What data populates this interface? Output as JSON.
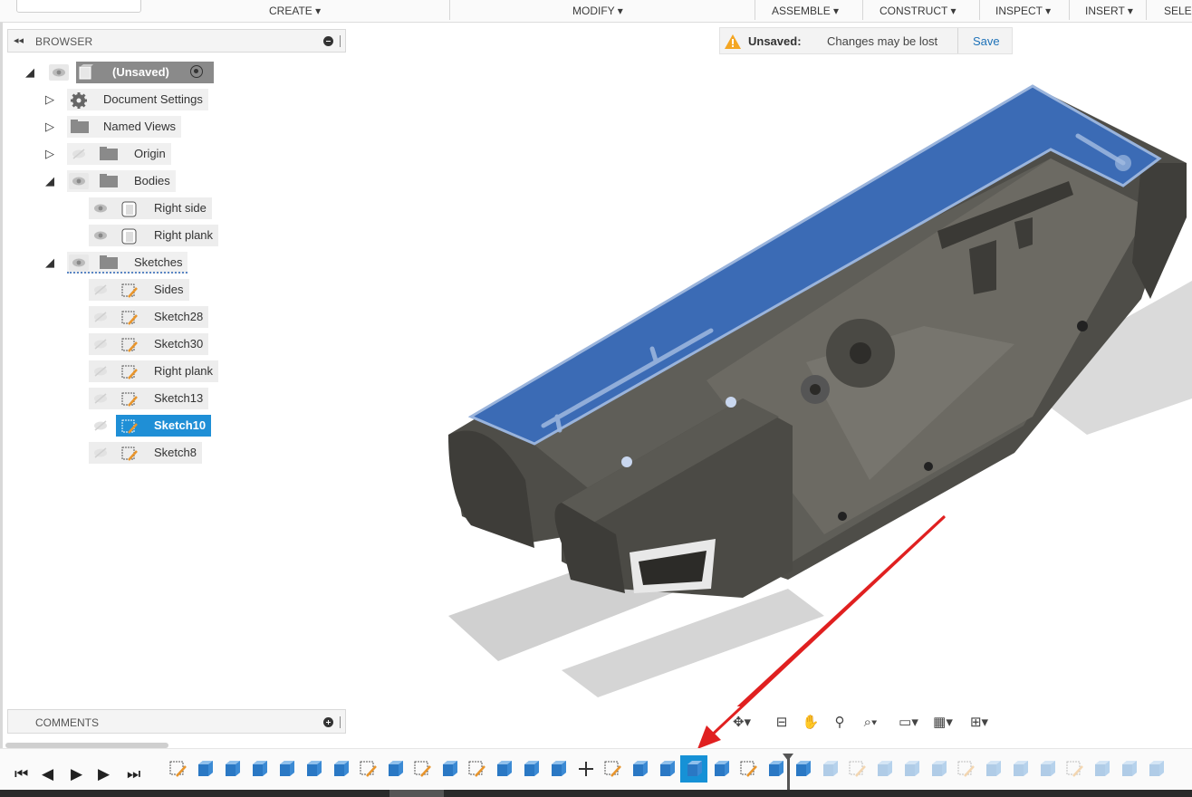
{
  "toolbar": {
    "create": "CREATE ▾",
    "modify": "MODIFY ▾",
    "assemble": "ASSEMBLE ▾",
    "construct": "CONSTRUCT ▾",
    "inspect": "INSPECT ▾",
    "insert": "INSERT ▾",
    "select": "SELE"
  },
  "browser": {
    "title": "BROWSER",
    "root": "(Unsaved)",
    "items": [
      {
        "label": "Document Settings",
        "icon": "gear-icon"
      },
      {
        "label": "Named Views",
        "icon": "folder-icon"
      },
      {
        "label": "Origin",
        "icon": "folder-icon"
      },
      {
        "label": "Bodies",
        "icon": "folder-icon"
      }
    ],
    "bodies": [
      "Right side",
      "Right plank"
    ],
    "sketches_label": "Sketches",
    "sketches": [
      "Sides",
      "Sketch28",
      "Sketch30",
      "Right plank",
      "Sketch13",
      "Sketch10",
      "Sketch8"
    ],
    "selected_sketch": "Sketch10"
  },
  "comments": {
    "title": "COMMENTS"
  },
  "banner": {
    "status": "Unsaved:",
    "message": "Changes may be lost",
    "save": "Save"
  },
  "colors": {
    "accent": "#1f8fd6",
    "model_face": "#3b6bb5",
    "model_metal": "#54534d",
    "arrow": "#e02020"
  }
}
